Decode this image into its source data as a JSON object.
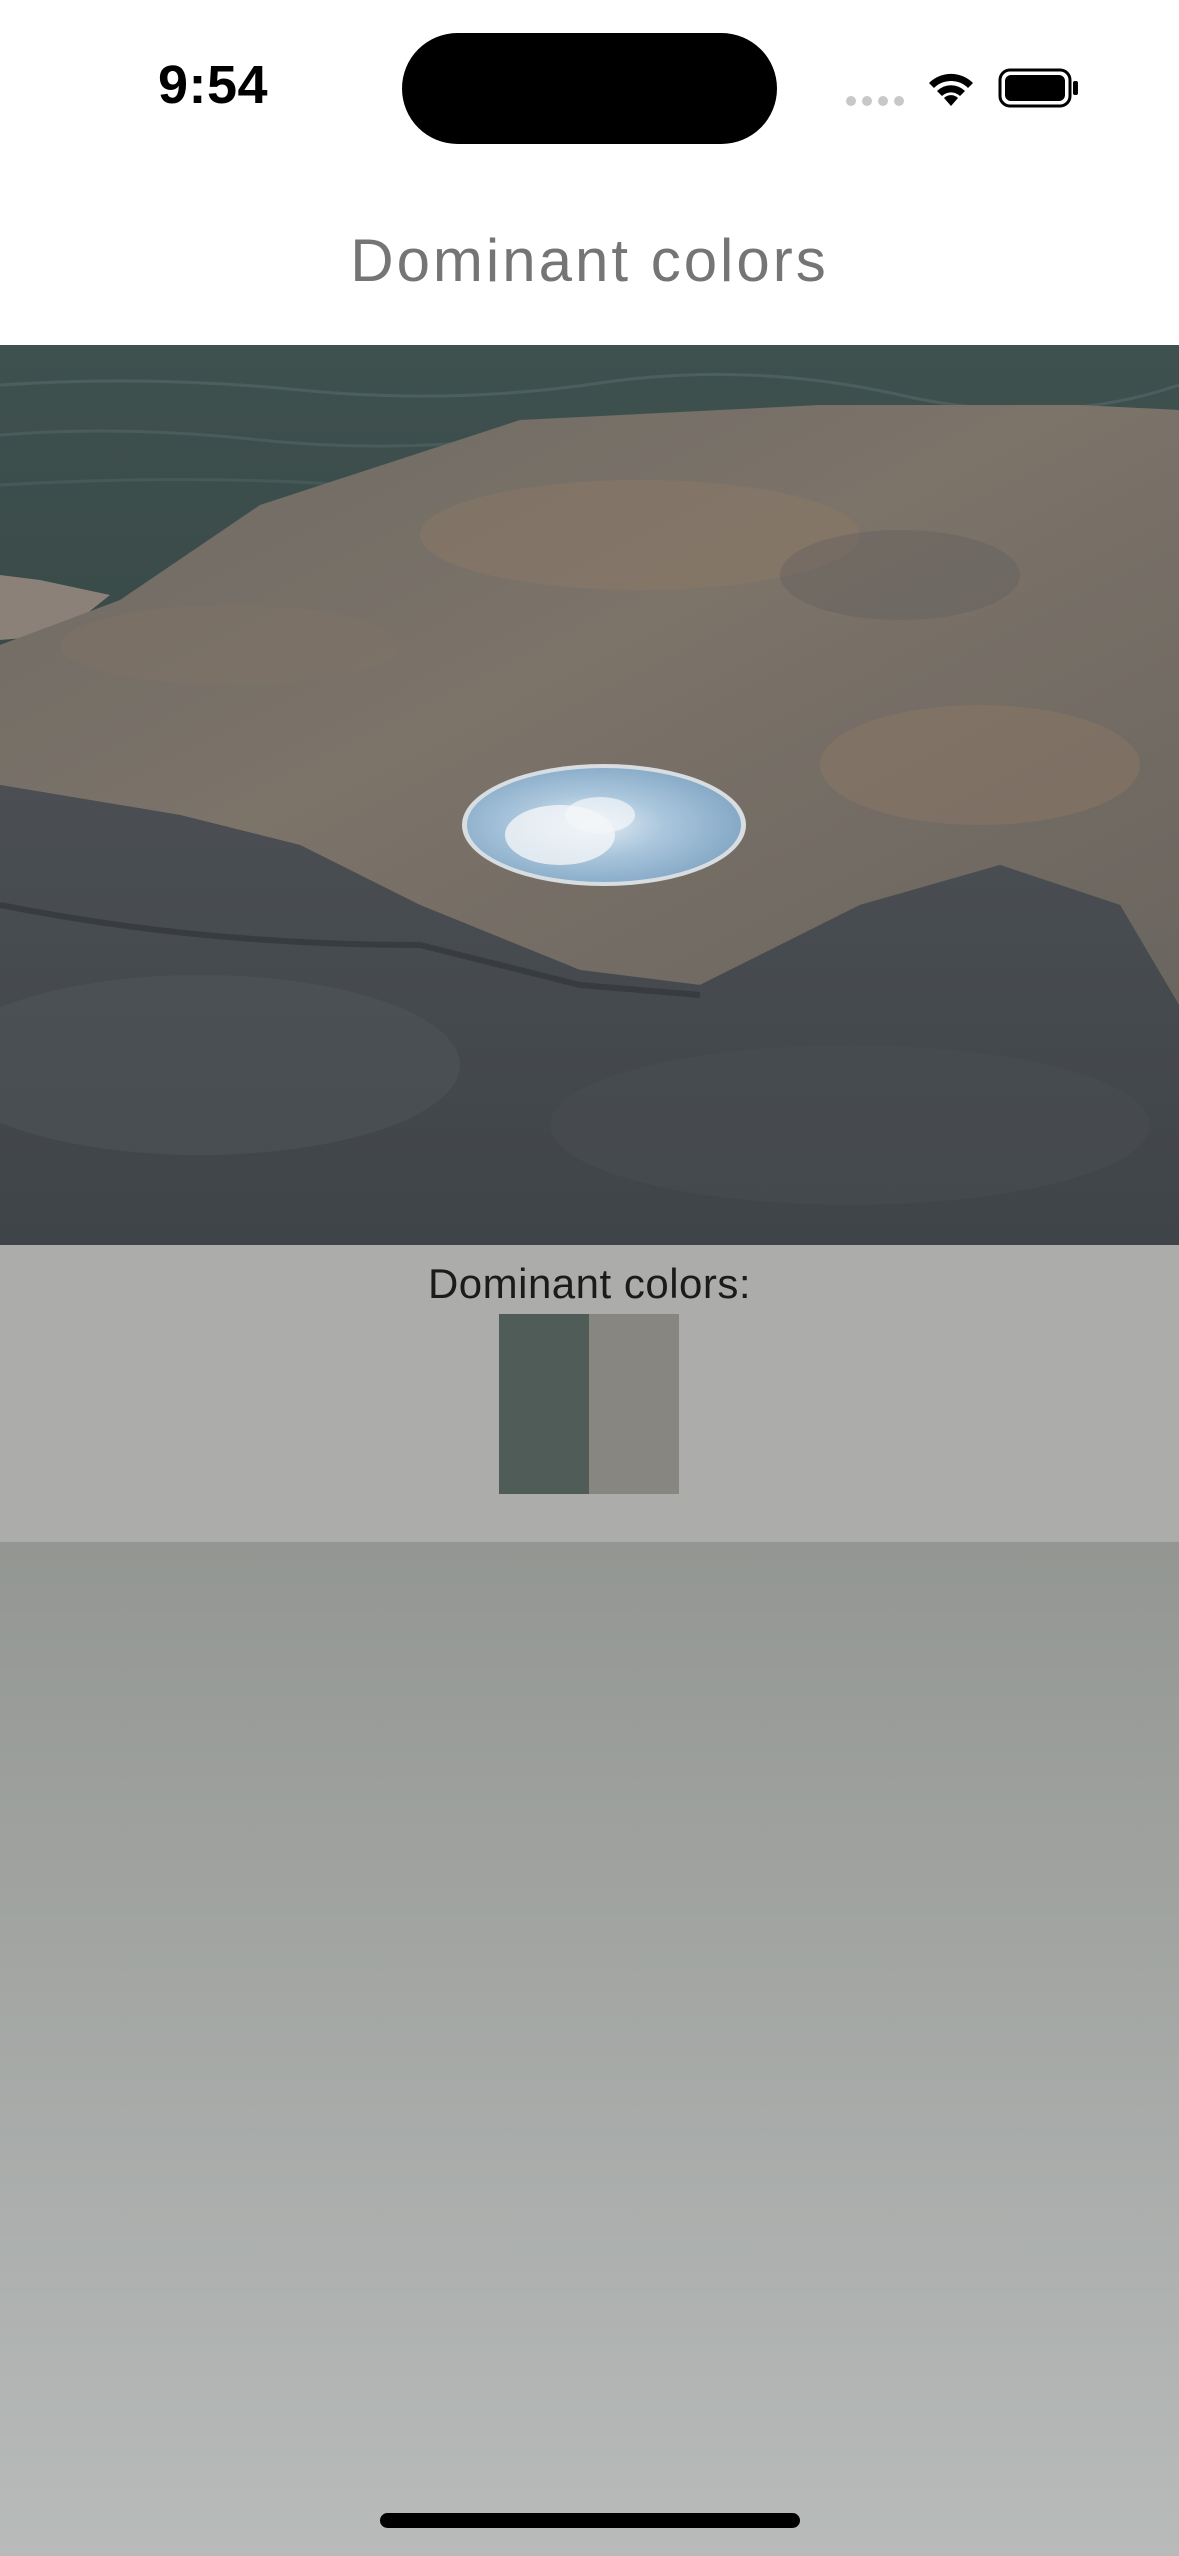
{
  "status_bar": {
    "time": "9:54"
  },
  "nav": {
    "title": "Dominant colors"
  },
  "photo": {
    "description_icon": "photo-rock-mirror"
  },
  "dominant": {
    "label": "Dominant colors:",
    "colors": [
      "#4f5c58",
      "#878680"
    ]
  },
  "background": {
    "section_color": "#acadaa",
    "gradient_top": "#939692",
    "gradient_bottom": "#b8bbba"
  }
}
